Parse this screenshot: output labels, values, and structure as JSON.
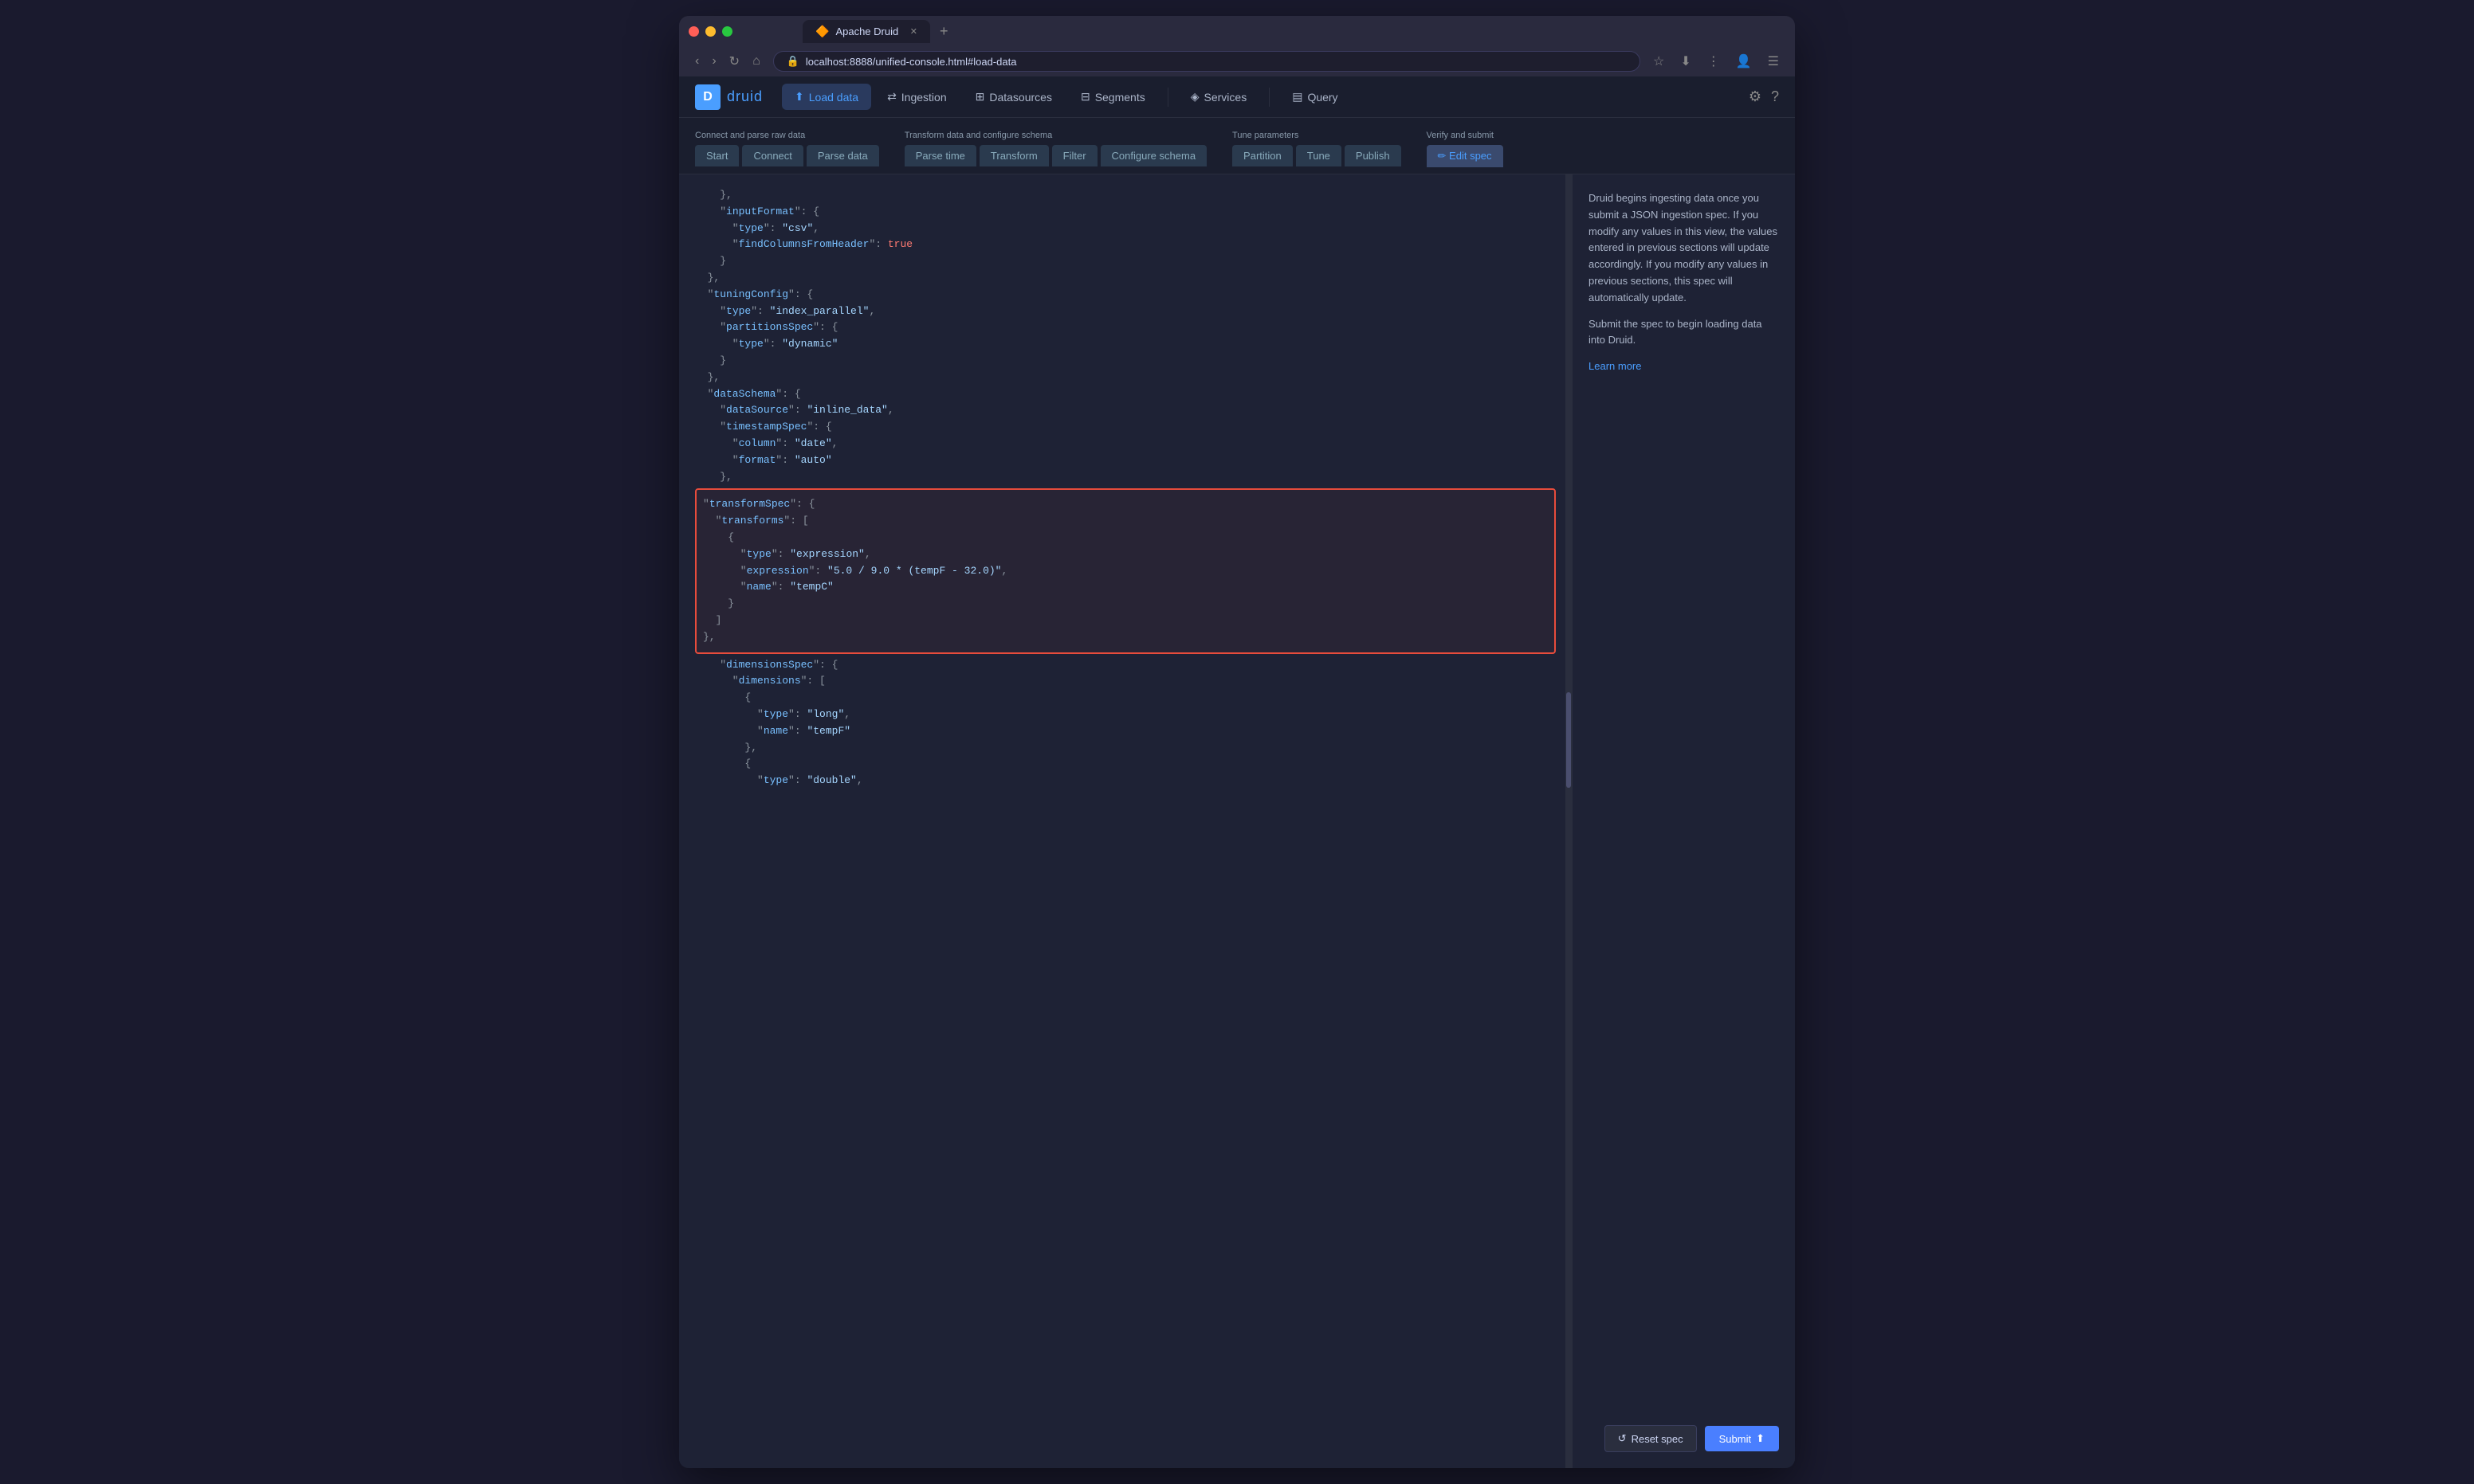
{
  "browser": {
    "tab_title": "Apache Druid",
    "tab_favicon": "🔶",
    "url": "localhost:8888/unified-console.html#load-data",
    "new_tab_icon": "+"
  },
  "nav": {
    "logo_text": "druid",
    "items": [
      {
        "id": "load-data",
        "label": "Load data",
        "icon": "⬆",
        "active": true
      },
      {
        "id": "ingestion",
        "label": "Ingestion",
        "icon": "⇄",
        "active": false
      },
      {
        "id": "datasources",
        "label": "Datasources",
        "icon": "⊞",
        "active": false
      },
      {
        "id": "segments",
        "label": "Segments",
        "icon": "⊟",
        "active": false
      },
      {
        "id": "services",
        "label": "Services",
        "icon": "◈",
        "active": false
      },
      {
        "id": "query",
        "label": "Query",
        "icon": "▤",
        "active": false
      }
    ],
    "settings_icon": "⚙",
    "help_icon": "?"
  },
  "steps": {
    "group1": {
      "label": "Connect and parse raw data",
      "tabs": [
        {
          "id": "start",
          "label": "Start"
        },
        {
          "id": "connect",
          "label": "Connect"
        },
        {
          "id": "parse-data",
          "label": "Parse data"
        }
      ]
    },
    "group2": {
      "label": "Transform data and configure schema",
      "tabs": [
        {
          "id": "parse-time",
          "label": "Parse time"
        },
        {
          "id": "transform",
          "label": "Transform"
        },
        {
          "id": "filter",
          "label": "Filter"
        },
        {
          "id": "configure-schema",
          "label": "Configure schema"
        }
      ]
    },
    "group3": {
      "label": "Tune parameters",
      "tabs": [
        {
          "id": "partition",
          "label": "Partition"
        },
        {
          "id": "tune",
          "label": "Tune"
        },
        {
          "id": "publish",
          "label": "Publish"
        }
      ]
    },
    "group4": {
      "label": "Verify and submit",
      "tabs": [
        {
          "id": "edit-spec",
          "label": "✏ Edit spec",
          "active": true
        }
      ]
    }
  },
  "code": {
    "lines": [
      "    },",
      "    \"inputFormat\": {",
      "      \"type\": \"csv\",",
      "      \"findColumnsFromHeader\": true",
      "    }",
      "  },",
      "  \"tuningConfig\": {",
      "    \"type\": \"index_parallel\",",
      "    \"partitionsSpec\": {",
      "      \"type\": \"dynamic\"",
      "    }",
      "  },",
      "  \"dataSchema\": {",
      "    \"dataSource\": \"inline_data\",",
      "    \"timestampSpec\": {",
      "      \"column\": \"date\",",
      "      \"format\": \"auto\"",
      "    },",
      "    \"transformSpec\": {",
      "      \"transforms\": [",
      "        {",
      "          \"type\": \"expression\",",
      "          \"expression\": \"5.0 / 9.0 * (tempF - 32.0)\",",
      "          \"name\": \"tempC\"",
      "        }",
      "      ]",
      "    },",
      "    \"dimensionsSpec\": {",
      "      \"dimensions\": [",
      "        {",
      "          \"type\": \"long\",",
      "          \"name\": \"tempF\"",
      "        },",
      "        {",
      "          \"type\": \"double\","
    ]
  },
  "panel": {
    "description1": "Druid begins ingesting data once you submit a JSON ingestion spec. If you modify any values in this view, the values entered in previous sections will update accordingly. If you modify any values in previous sections, this spec will automatically update.",
    "description2": "Submit the spec to begin loading data into Druid.",
    "learn_more": "Learn more",
    "reset_label": "Reset spec",
    "submit_label": "Submit",
    "reset_icon": "↺",
    "submit_icon": "⬆"
  }
}
